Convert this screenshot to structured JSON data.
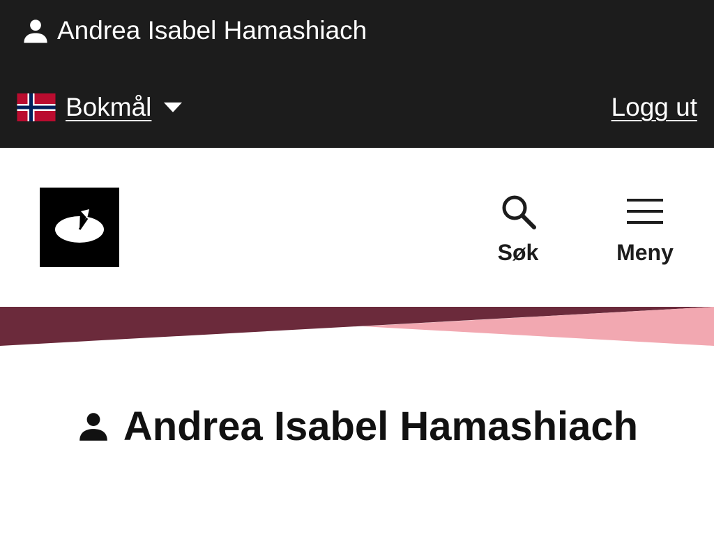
{
  "topbar": {
    "user_name": "Andrea Isabel Hamashiach",
    "user_icon": "person-icon",
    "language": {
      "label": "Bokmål",
      "flag_icon": "norway-flag-icon",
      "caret_icon": "caret-down-icon"
    },
    "logout_label": "Logg ut",
    "background": "#1c1c1c"
  },
  "header": {
    "logo_icon": "site-logo",
    "search": {
      "label": "Søk",
      "icon": "search-icon"
    },
    "menu": {
      "label": "Meny",
      "icon": "hamburger-icon"
    }
  },
  "band_colors": {
    "dark": "#6b2a3b",
    "light": "#f2a8b1"
  },
  "page": {
    "title": "Andrea Isabel Hamashiach",
    "title_icon": "person-icon"
  }
}
